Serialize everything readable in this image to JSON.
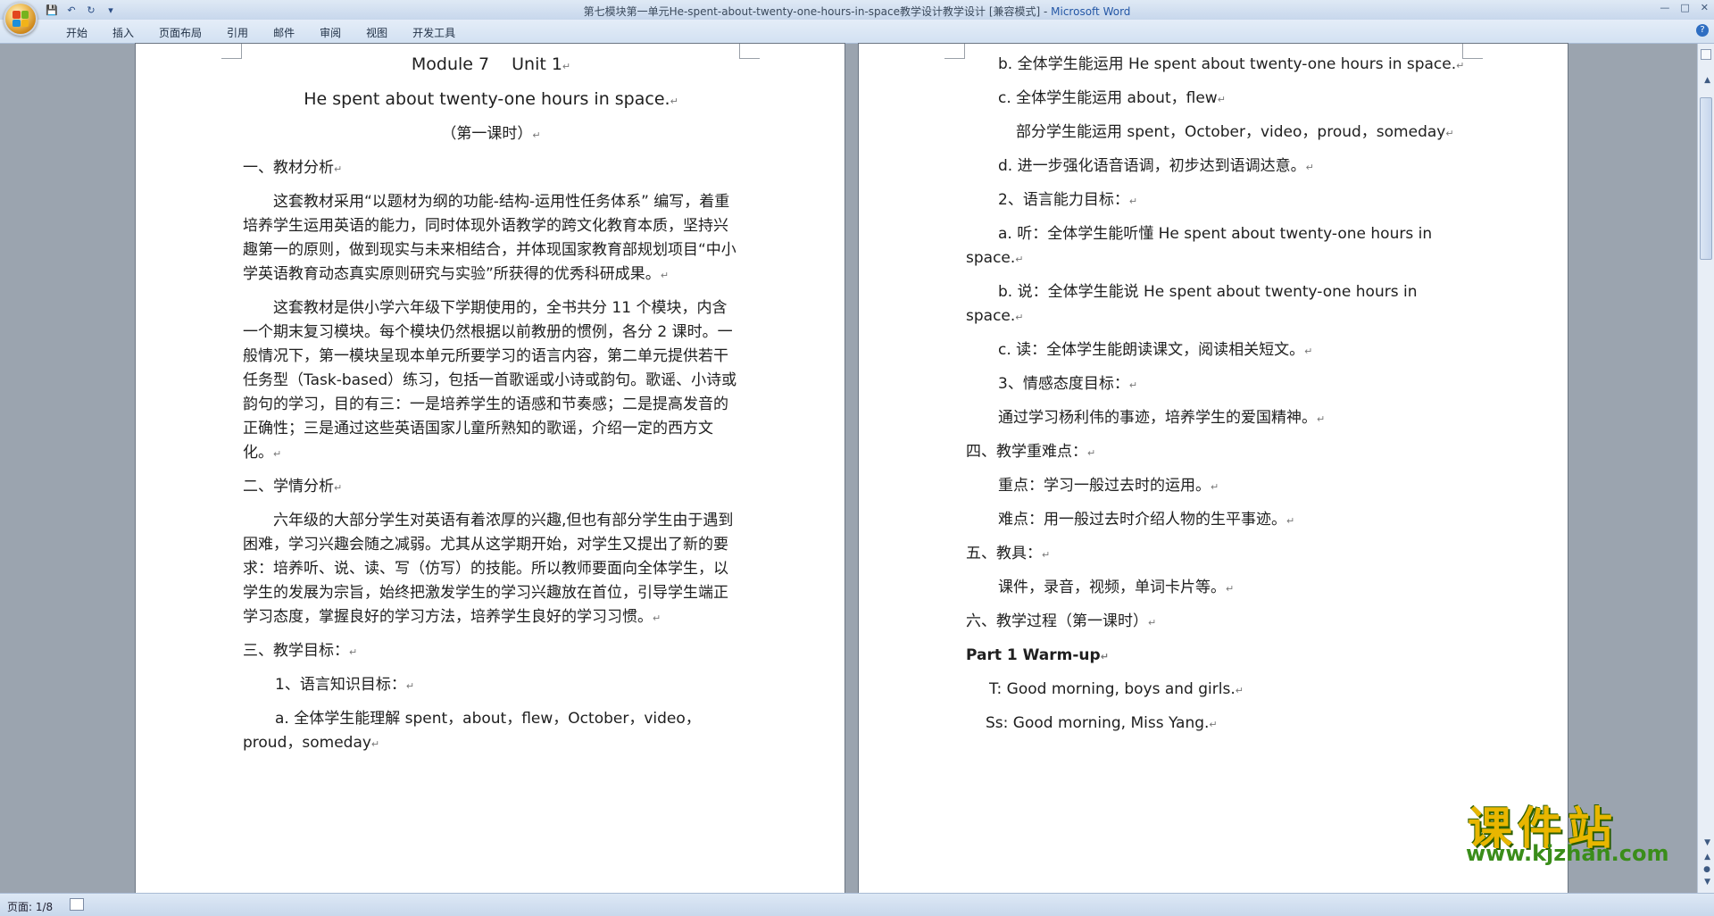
{
  "window": {
    "title": "第七模块第一单元He-spent-about-twenty-one-hours-in-space教学设计教学设计 [兼容模式] - ",
    "brand": "Microsoft Word"
  },
  "ribbon": {
    "tabs": [
      "开始",
      "插入",
      "页面布局",
      "引用",
      "邮件",
      "审阅",
      "视图",
      "开发工具"
    ]
  },
  "left_page": {
    "heading1": "Module 7　 Unit 1",
    "heading2": "He spent about twenty-one hours in space.",
    "heading3": "（第一课时）",
    "sec1": "一、教材分析",
    "p1": "　　这套教材采用“以题材为纲的功能-结构-运用性任务体系” 编写，着重培养学生运用英语的能力，同时体现外语教学的跨文化教育本质，坚持兴趣第一的原则，做到现实与未来相结合，并体现国家教育部规划项目“中小学英语教育动态真实原则研究与实验”所获得的优秀科研成果。",
    "p2": "　　这套教材是供小学六年级下学期使用的，全书共分 11 个模块，内含一个期末复习模块。每个模块仍然根据以前教册的惯例，各分 2 课时。一般情况下，第一模块呈现本单元所要学习的语言内容，第二单元提供若干任务型（Task-based）练习，包括一首歌谣或小诗或韵句。歌谣、小诗或韵句的学习，目的有三：一是培养学生的语感和节奏感；二是提高发音的正确性；三是通过这些英语国家儿童所熟知的歌谣，介绍一定的西方文化。",
    "sec2": "二、学情分析",
    "p3": "　　六年级的大部分学生对英语有着浓厚的兴趣,但也有部分学生由于遇到困难，学习兴趣会随之减弱。尤其从这学期开始，对学生又提出了新的要求：培养听、说、读、写（仿写）的技能。所以教师要面向全体学生，以学生的发展为宗旨，始终把激发学生的学习兴趣放在首位，引导学生端正学习态度，掌握良好的学习方法，培养学生良好的学习习惯。",
    "sec3": "三、教学目标：",
    "goal1": "1、语言知识目标：",
    "goal_a": "a. 全体学生能理解 spent，about，flew，October，video，proud，someday"
  },
  "right_page": {
    "b1": "b. 全体学生能运用 He spent about twenty-one hours in space.",
    "c1": "c. 全体学生能运用 about，flew",
    "c1b": "部分学生能运用 spent，October，video，proud，someday",
    "d1": "d. 进一步强化语音语调，初步达到语调达意。",
    "goal2": "2、语言能力目标：",
    "a2": "a. 听：全体学生能听懂 He spent about twenty-one hours in space.",
    "b2": "b. 说：全体学生能说 He spent about twenty-one hours in space.",
    "c2": "c. 读：全体学生能朗读课文，阅读相关短文。",
    "goal3": "3、情感态度目标：",
    "g3text": "通过学习杨利伟的事迹，培养学生的爱国精神。",
    "sec4": "四、教学重难点：",
    "key": "重点：学习一般过去时的运用。",
    "difficult": "难点：用一般过去时介绍人物的生平事迹。",
    "sec5": "五、教具：",
    "tools": "课件，录音，视频，单词卡片等。",
    "sec6": "六、教学过程（第一课时）",
    "part1": "Part 1 Warm-up",
    "t1": "T: Good morning, boys and girls.",
    "s1": "Ss: Good morning, Miss Yang."
  },
  "status": {
    "page": "页面: 1/8"
  },
  "watermark": {
    "title": "课件站",
    "url": "www.kjzhan.com"
  },
  "colors": {
    "title_bar": "#c7d7ec",
    "doc_background": "#9ba4af",
    "brand": "#2457a6"
  }
}
